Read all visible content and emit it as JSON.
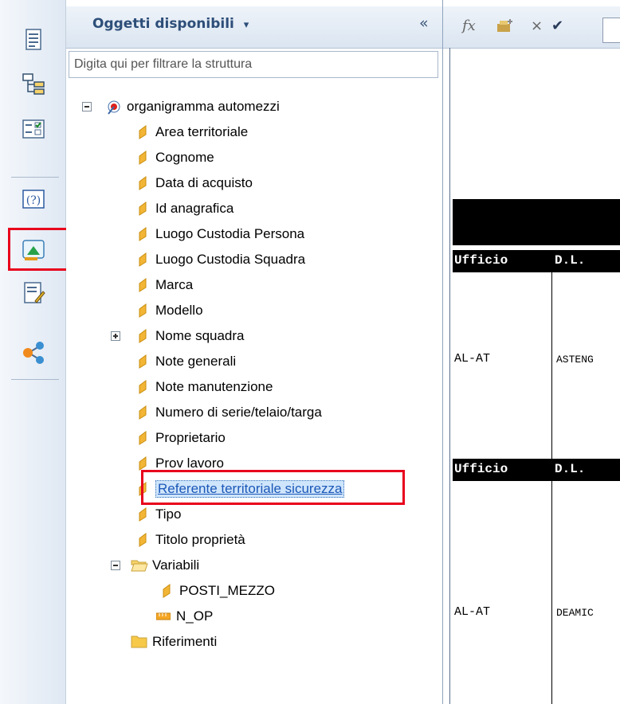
{
  "panel": {
    "title": "Oggetti disponibili",
    "title_arrow": "▾",
    "collapse": "«",
    "filter_placeholder": "Digita qui per filtrare la struttura"
  },
  "tree": {
    "root": "organigramma automezzi",
    "items": [
      "Area territoriale",
      "Cognome",
      "Data di acquisto",
      "Id anagrafica",
      "Luogo Custodia Persona",
      "Luogo Custodia Squadra",
      "Marca",
      "Modello",
      "Nome squadra",
      "Note generali",
      "Note manutenzione",
      "Numero di serie/telaio/targa",
      "Proprietario",
      "Prov lavoro",
      "Referente territoriale sicurezza",
      "Tipo",
      "Titolo proprietà"
    ],
    "variables_folder": "Variabili",
    "variables": [
      "POSTI_MEZZO",
      "N_OP"
    ],
    "references_folder": "Riferimenti"
  },
  "formula_bar": {
    "fx": "fx",
    "cancel": "×",
    "accept": "✔"
  },
  "report": {
    "header1": [
      "Ufficio",
      "D.L."
    ],
    "row1": [
      "AL-AT",
      "ASTENG"
    ],
    "header2": [
      "Ufficio",
      "D.L."
    ],
    "row2": [
      "AL-AT",
      "DEAMIC"
    ]
  },
  "colors": {
    "highlight": "#e8001c",
    "selection_text": "#1c58b8",
    "panel_title": "#2d4e79"
  },
  "icons": [
    "document-icon",
    "structure-icon",
    "checklist-icon",
    "help-icon",
    "data-chart-icon",
    "edit-document-icon",
    "share-icon"
  ]
}
